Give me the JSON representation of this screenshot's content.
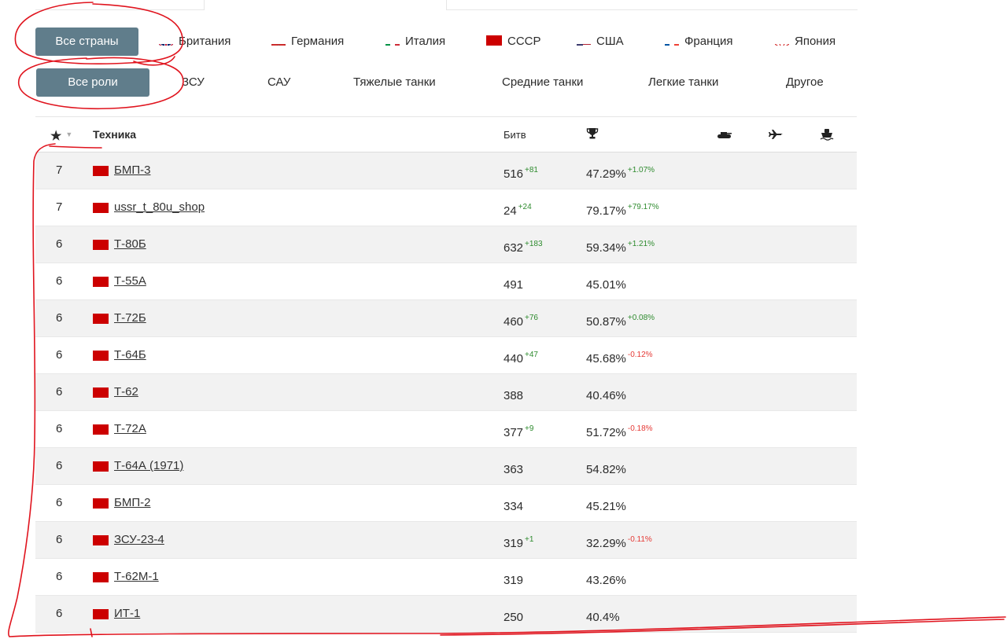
{
  "nations": {
    "active": "Все страны",
    "options": [
      {
        "label": "Британия",
        "flag": "uk-flag-icon"
      },
      {
        "label": "Германия",
        "flag": "germany-flag-icon"
      },
      {
        "label": "Италия",
        "flag": "italy-flag-icon"
      },
      {
        "label": "СССР",
        "flag": "ussr-flag-icon"
      },
      {
        "label": "США",
        "flag": "usa-flag-icon"
      },
      {
        "label": "Франция",
        "flag": "france-flag-icon"
      },
      {
        "label": "Япония",
        "flag": "japan-flag-icon"
      }
    ]
  },
  "roles": {
    "active": "Все роли",
    "options": [
      "ЗСУ",
      "САУ",
      "Тяжелые танки",
      "Средние танки",
      "Легкие танки",
      "Другое"
    ]
  },
  "table": {
    "columns": {
      "rank_icon": "star-icon",
      "vehicle": "Техника",
      "battles": "Битв",
      "win_icon": "trophy-icon",
      "ground_icon": "tank-icon",
      "air_icon": "plane-icon",
      "naval_icon": "ship-icon"
    },
    "rows": [
      {
        "rank": "7",
        "name": "БМП-3",
        "battles": "516",
        "battles_delta": "+81",
        "win": "47.29%",
        "win_delta": "+1.07%"
      },
      {
        "rank": "7",
        "name": "ussr_t_80u_shop",
        "battles": "24",
        "battles_delta": "+24",
        "win": "79.17%",
        "win_delta": "+79.17%"
      },
      {
        "rank": "6",
        "name": "Т-80Б",
        "battles": "632",
        "battles_delta": "+183",
        "win": "59.34%",
        "win_delta": "+1.21%"
      },
      {
        "rank": "6",
        "name": "Т-55А",
        "battles": "491",
        "battles_delta": "",
        "win": "45.01%",
        "win_delta": ""
      },
      {
        "rank": "6",
        "name": "Т-72Б",
        "battles": "460",
        "battles_delta": "+76",
        "win": "50.87%",
        "win_delta": "+0.08%"
      },
      {
        "rank": "6",
        "name": "Т-64Б",
        "battles": "440",
        "battles_delta": "+47",
        "win": "45.68%",
        "win_delta": "-0.12%"
      },
      {
        "rank": "6",
        "name": "Т-62",
        "battles": "388",
        "battles_delta": "",
        "win": "40.46%",
        "win_delta": ""
      },
      {
        "rank": "6",
        "name": "Т-72А",
        "battles": "377",
        "battles_delta": "+9",
        "win": "51.72%",
        "win_delta": "-0.18%"
      },
      {
        "rank": "6",
        "name": "Т-64А (1971)",
        "battles": "363",
        "battles_delta": "",
        "win": "54.82%",
        "win_delta": ""
      },
      {
        "rank": "6",
        "name": "БМП-2",
        "battles": "334",
        "battles_delta": "",
        "win": "45.21%",
        "win_delta": ""
      },
      {
        "rank": "6",
        "name": "ЗСУ-23-4",
        "battles": "319",
        "battles_delta": "+1",
        "win": "32.29%",
        "win_delta": "-0.11%"
      },
      {
        "rank": "6",
        "name": "Т-62М-1",
        "battles": "319",
        "battles_delta": "",
        "win": "43.26%",
        "win_delta": ""
      },
      {
        "rank": "6",
        "name": "ИТ-1",
        "battles": "250",
        "battles_delta": "",
        "win": "40.4%",
        "win_delta": ""
      }
    ]
  },
  "colors": {
    "active_pill": "#607d8b",
    "ussr_flag": "#cc0000",
    "positive_delta": "#2e8b2e",
    "negative_delta": "#e53935",
    "annotation": "#e0141e"
  }
}
